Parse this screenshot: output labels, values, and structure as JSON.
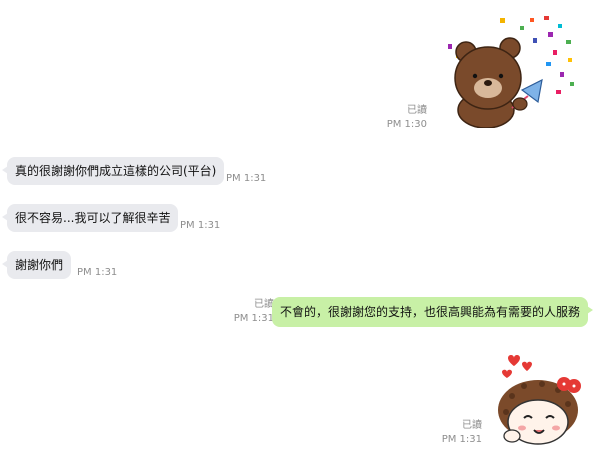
{
  "messages": [
    {
      "text": "真的很謝謝你們成立這樣的公司(平台)",
      "time": "PM 1:31"
    },
    {
      "text": "很不容易...我可以了解很辛苦",
      "time": "PM 1:31"
    },
    {
      "text": "謝謝你們",
      "time": "PM 1:31"
    },
    {
      "text": "不會的，很謝謝您的支持，也很高興能為有需要的人服務",
      "read": "已讀",
      "time": "PM 1:31"
    }
  ],
  "stickers": [
    {
      "name": "brown-bear-party-popper-icon",
      "read": "已讀",
      "time": "PM 1:30"
    },
    {
      "name": "girl-with-hearts-icon",
      "read": "已讀",
      "time": "PM 1:31"
    }
  ],
  "colors": {
    "incoming": "#e9eaee",
    "outgoing": "#c8f0a6",
    "meta": "#8e8e8e"
  }
}
